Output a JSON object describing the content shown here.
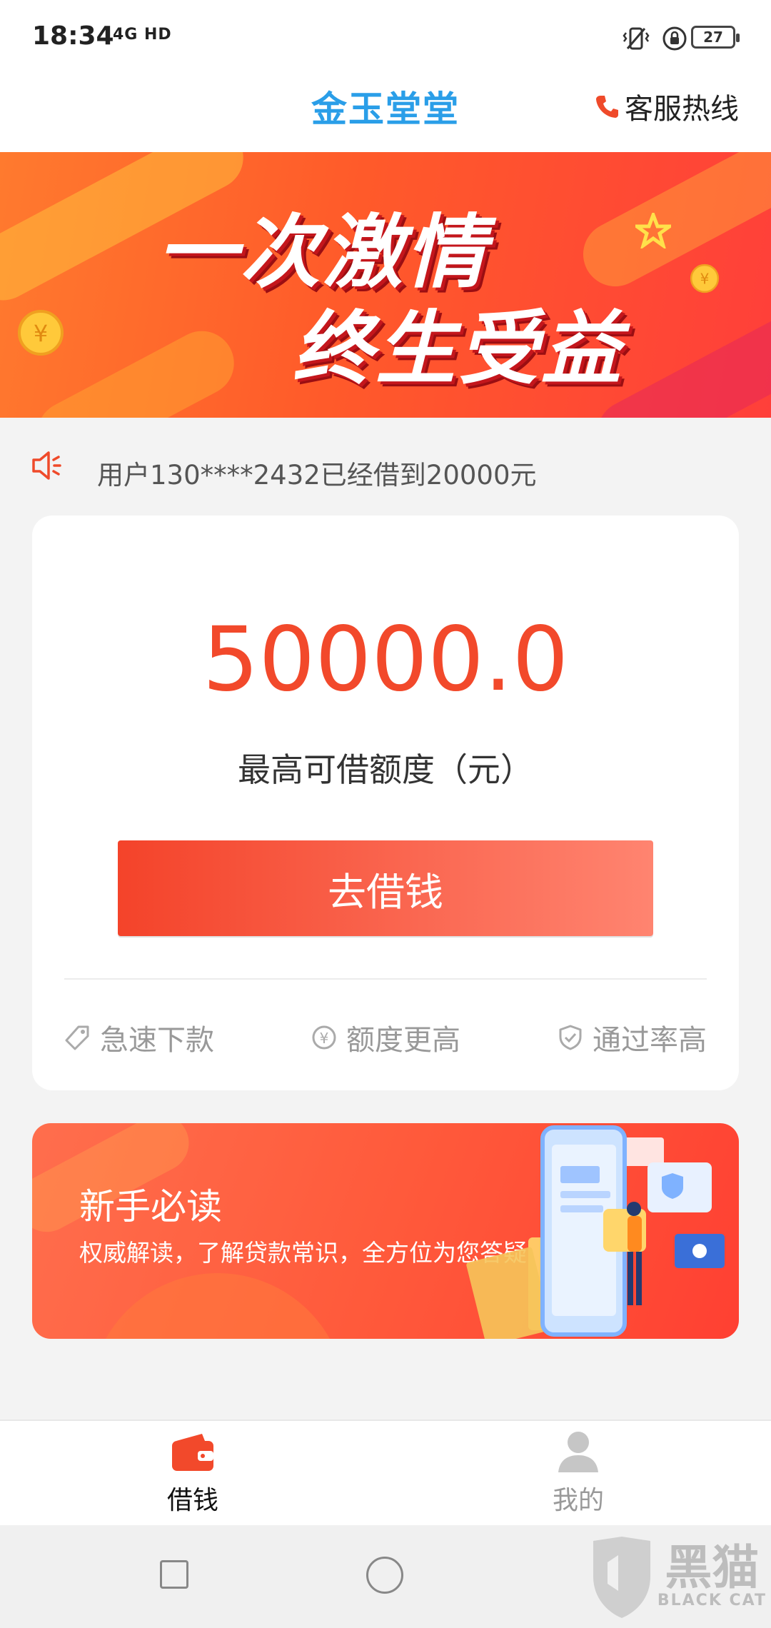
{
  "status_bar": {
    "time": "18:34",
    "network": "4G HD",
    "battery": "27"
  },
  "header": {
    "title": "金玉堂堂",
    "hotline_label": "客服热线"
  },
  "banner": {
    "line1": "一次激情",
    "line2": "终生受益"
  },
  "notice": {
    "text": "用户130****2432已经借到20000元"
  },
  "loan_card": {
    "amount": "50000.0",
    "amount_label": "最高可借额度（元）",
    "button_label": "去借钱",
    "features": [
      "急速下款",
      "额度更高",
      "通过率高"
    ]
  },
  "guide_banner": {
    "title": "新手必读",
    "subtitle": "权威解读，了解贷款常识，全方位为您答疑"
  },
  "bottom_nav": {
    "items": [
      {
        "label": "借钱",
        "active": true
      },
      {
        "label": "我的",
        "active": false
      }
    ]
  },
  "watermark": {
    "text": "黑猫",
    "sub": "BLACK CAT"
  },
  "colors": {
    "accent": "#f2492b",
    "title_blue": "#2a9ee8",
    "inactive": "#999999"
  }
}
